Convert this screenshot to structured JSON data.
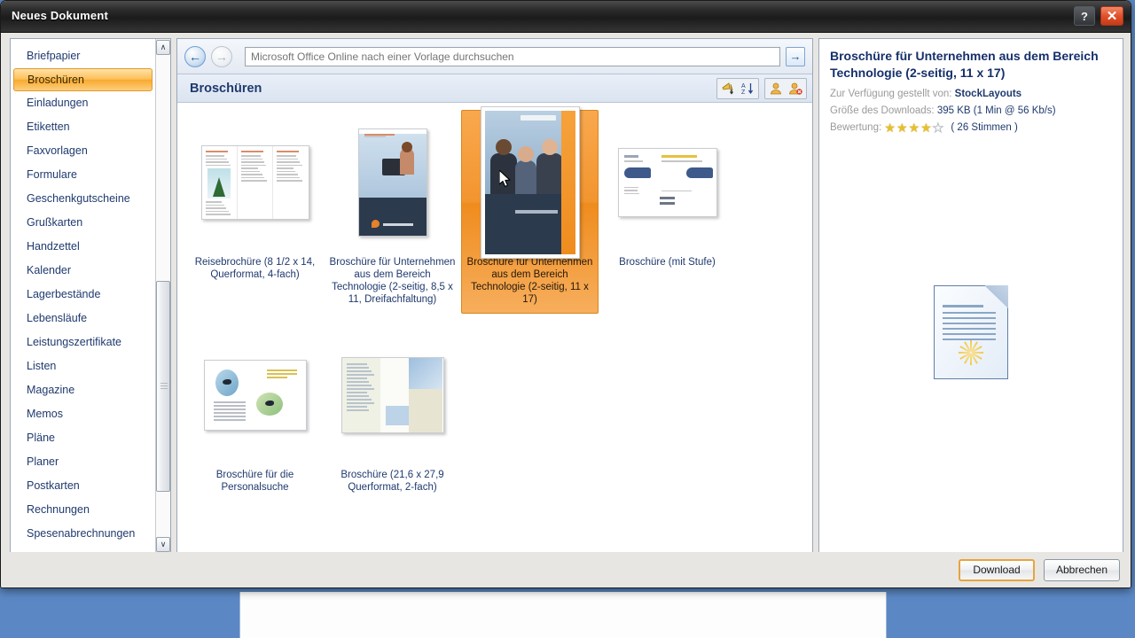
{
  "window": {
    "title": "Neues Dokument",
    "help_label": "?",
    "close_label": "✕"
  },
  "sidebar": {
    "items": [
      {
        "label": "Briefpapier",
        "selected": false
      },
      {
        "label": "Broschüren",
        "selected": true
      },
      {
        "label": "Einladungen",
        "selected": false
      },
      {
        "label": "Etiketten",
        "selected": false
      },
      {
        "label": "Faxvorlagen",
        "selected": false
      },
      {
        "label": "Formulare",
        "selected": false
      },
      {
        "label": "Geschenkgutscheine",
        "selected": false
      },
      {
        "label": "Grußkarten",
        "selected": false
      },
      {
        "label": "Handzettel",
        "selected": false
      },
      {
        "label": "Kalender",
        "selected": false
      },
      {
        "label": "Lagerbestände",
        "selected": false
      },
      {
        "label": "Lebensläufe",
        "selected": false
      },
      {
        "label": "Leistungszertifikate",
        "selected": false
      },
      {
        "label": "Listen",
        "selected": false
      },
      {
        "label": "Magazine",
        "selected": false
      },
      {
        "label": "Memos",
        "selected": false
      },
      {
        "label": "Pläne",
        "selected": false
      },
      {
        "label": "Planer",
        "selected": false
      },
      {
        "label": "Postkarten",
        "selected": false
      },
      {
        "label": "Rechnungen",
        "selected": false
      },
      {
        "label": "Spesenabrechnungen",
        "selected": false
      }
    ],
    "scroll_up_glyph": "∧",
    "scroll_down_glyph": "∨"
  },
  "search": {
    "back_glyph": "←",
    "forward_glyph": "→",
    "value": "",
    "placeholder": "Microsoft Office Online nach einer Vorlage durchsuchen",
    "go_glyph": "→"
  },
  "section": {
    "title": "Broschüren",
    "tools": [
      {
        "name": "pin-sort-icon"
      },
      {
        "name": "sort-az-icon"
      },
      {
        "name": "user-icon"
      },
      {
        "name": "user-remove-icon"
      }
    ]
  },
  "templates": [
    {
      "label": "Reisebrochüre (8 1/2 x 14, Querformat, 4-fach)",
      "art": "trifold",
      "selected": false
    },
    {
      "label": "Broschüre für Unternehmen aus dem Bereich Technologie (2-seitig, 8,5 x 11, Dreifachfaltung)",
      "art": "tech2",
      "selected": false
    },
    {
      "label": "Broschüre für Unternehmen aus dem Bereich Technologie (2-seitig, 11 x 17)",
      "art": "tech11",
      "selected": true
    },
    {
      "label": "Broschüre (mit Stufe)",
      "art": "stufe",
      "selected": false
    },
    {
      "label": "Broschüre für die Personalsuche",
      "art": "personal",
      "selected": false
    },
    {
      "label": "Broschüre (21,6 x 27,9 Querformat, 2-fach)",
      "art": "blue2",
      "selected": false
    }
  ],
  "preview": {
    "title": "Broschüre für Unternehmen aus dem Bereich Technologie (2-seitig, 11 x 17)",
    "provider_label": "Zur Verfügung gestellt von:",
    "provider_value": "StockLayouts",
    "size_label": "Größe des Downloads:",
    "size_value": "395 KB (1 Min @ 56 Kb/s)",
    "rating_label": "Bewertung:",
    "rating_filled": 4,
    "rating_total": 5,
    "votes": "( 26 Stimmen )",
    "loading_icon": "document-loading-icon"
  },
  "footer": {
    "download_label": "Download",
    "cancel_label": "Abbrechen"
  },
  "colors": {
    "accent_orange": "#ef8c1e",
    "title_blue": "#16306b",
    "desktop_blue": "#5b88c5",
    "close_red": "#e04f28"
  }
}
